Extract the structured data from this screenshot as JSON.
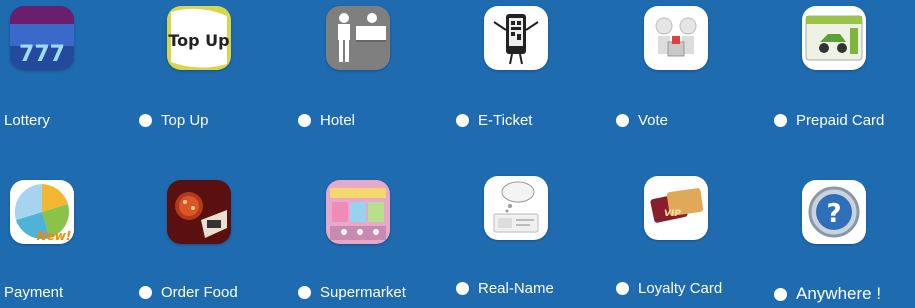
{
  "items": [
    {
      "label": "Lottery",
      "icon": "lottery-icon"
    },
    {
      "label": "Top Up",
      "icon": "top-up-icon",
      "icon_text": "Top Up"
    },
    {
      "label": "Hotel",
      "icon": "hotel-icon"
    },
    {
      "label": "E-Ticket",
      "icon": "e-ticket-icon"
    },
    {
      "label": "Vote",
      "icon": "vote-icon"
    },
    {
      "label": "Prepaid Card",
      "icon": "prepaid-card-icon"
    },
    {
      "label": "Payment",
      "icon": "payment-icon",
      "icon_text": "New!"
    },
    {
      "label": "Order Food",
      "icon": "order-food-icon"
    },
    {
      "label": "Supermarket",
      "icon": "supermarket-icon"
    },
    {
      "label": "Real-Name",
      "icon": "real-name-icon"
    },
    {
      "label": "Loyalty Card",
      "icon": "loyalty-card-icon",
      "icon_text": "VIP"
    },
    {
      "label": "Anywhere !",
      "icon": "anywhere-icon",
      "icon_text": "?"
    }
  ],
  "colors": {
    "background": "#1e6bb0",
    "label_text": "#ffffff",
    "bullet": "#ffffff"
  }
}
